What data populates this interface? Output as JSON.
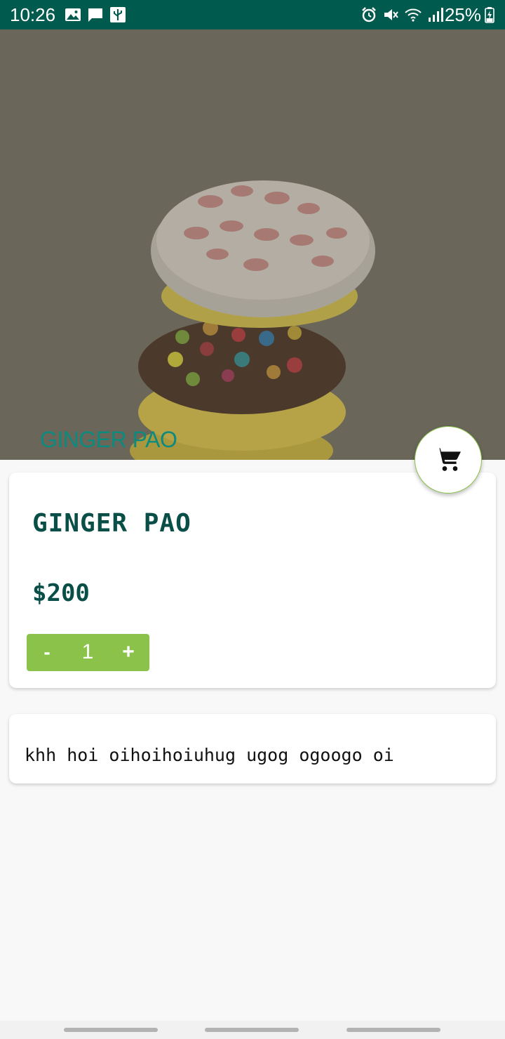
{
  "status_bar": {
    "time": "10:26",
    "battery": "25%",
    "icons_left": [
      "image-icon",
      "message-icon",
      "usb-icon"
    ],
    "icons_right": [
      "alarm-icon",
      "mute-icon",
      "wifi-icon",
      "signal-icon",
      "battery-icon"
    ],
    "background_color": "#005a4e"
  },
  "hero": {
    "title": "GINGER PAO",
    "image": "stacked-cookies-photo"
  },
  "cart_button": {
    "icon": "shopping-cart-icon"
  },
  "product": {
    "name": "GINGER PAO",
    "price": "$200",
    "quantity": {
      "minus": "-",
      "value": "1",
      "plus": "+",
      "color": "#8bc34a"
    }
  },
  "description": {
    "text": "khh hoi oihoihoiuhug ugog ogoogo oi"
  },
  "colors": {
    "accent": "#8bc34a",
    "title_text": "#0a4f47",
    "hero_title": "#0c8a7e"
  }
}
